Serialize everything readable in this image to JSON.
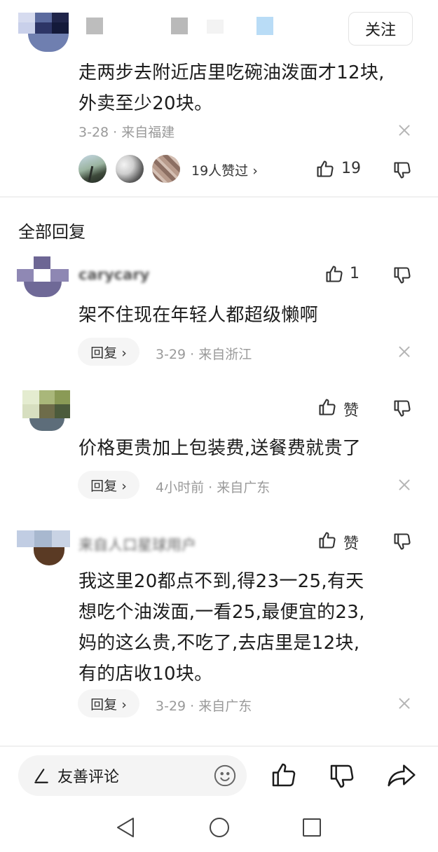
{
  "main_comment": {
    "follow_label": "关注",
    "text_lines": [
      "走两步去附近店里吃碗油泼面才12块,",
      "外卖至少20块。"
    ],
    "meta": "3-28 · 来自福建",
    "likers_label": "19人赞过 ›",
    "like_count": "19"
  },
  "section_title": "全部回复",
  "replies": [
    {
      "username": "carycary",
      "like_label": "1",
      "text_lines": [
        "架不住现在年轻人都超级懒啊"
      ],
      "reply_label": "回复 ›",
      "meta": "3-29 · 来自浙江"
    },
    {
      "username": "",
      "like_label": "赞",
      "text_lines": [
        "价格更贵加上包装费,送餐费就贵了"
      ],
      "reply_label": "回复 ›",
      "meta": "4小时前 · 来自广东"
    },
    {
      "username": "来自人口星球用户",
      "like_label": "赞",
      "text_lines": [
        "我这里20都点不到,得23一25,有天",
        "想吃个油泼面,一看25,最便宜的23,",
        "妈的这么贵,不吃了,去店里是12块,",
        "有的店收10块。"
      ],
      "reply_label": "回复 ›",
      "meta": "3-29 · 来自广东"
    }
  ],
  "bottom_bar": {
    "input_placeholder": "友善评论"
  },
  "colors": {
    "text": "#1c1c1c",
    "meta": "#9a9a9a",
    "icon": "#333333",
    "divider": "#f0f0f0"
  },
  "icons": [
    "pen-icon",
    "emoji-icon",
    "thumbs-up-icon",
    "thumbs-down-icon",
    "share-icon",
    "close-icon",
    "back-icon",
    "home-icon",
    "recents-icon"
  ]
}
